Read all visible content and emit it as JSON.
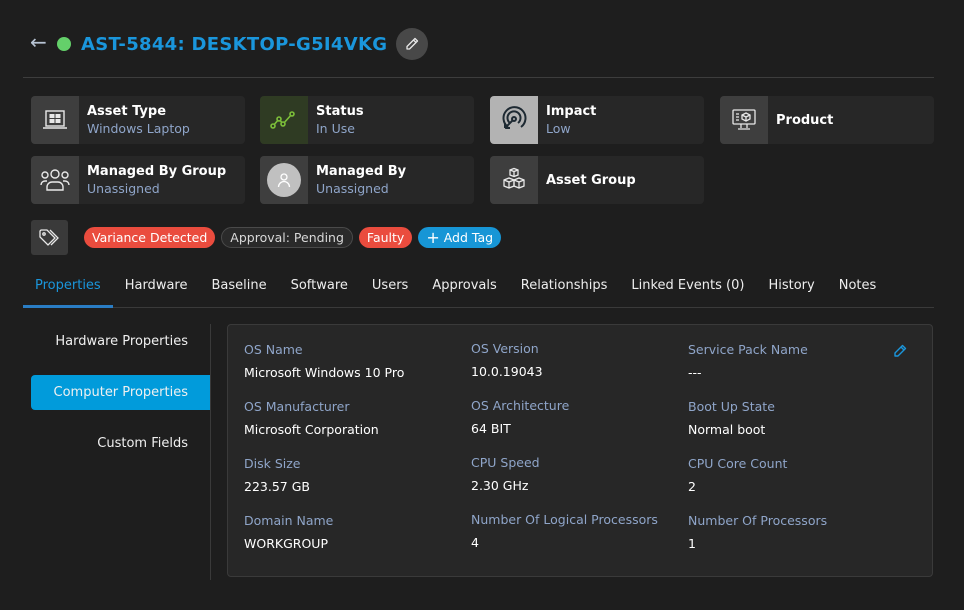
{
  "header": {
    "title": "AST-5844: DESKTOP-G5I4VKG",
    "back_icon": "arrow-left-icon",
    "status_color": "#64d06a",
    "edit_icon": "pencil-icon"
  },
  "cards": [
    {
      "label": "Asset Type",
      "value": "Windows Laptop",
      "icon": "windows-laptop-icon"
    },
    {
      "label": "Status",
      "value": "In Use",
      "icon": "status-line-icon"
    },
    {
      "label": "Impact",
      "value": "Low",
      "icon": "target-icon"
    },
    {
      "label": "Product",
      "value": "",
      "icon": "monitor-product-icon"
    },
    {
      "label": "Managed By Group",
      "value": "Unassigned",
      "icon": "users-group-icon"
    },
    {
      "label": "Managed By",
      "value": "Unassigned",
      "icon": "user-avatar-icon"
    },
    {
      "label": "Asset Group",
      "value": "",
      "icon": "boxes-icon"
    }
  ],
  "tags": {
    "icon": "tag-icon",
    "items": [
      {
        "label": "Variance Detected",
        "color": "#ea4c3e"
      },
      {
        "label": "Approval: Pending",
        "color": "#2a2a2a"
      },
      {
        "label": "Faulty",
        "color": "#ea4c3e"
      }
    ],
    "add_label": "Add Tag",
    "add_plus": "+"
  },
  "tabs": [
    {
      "label": "Properties",
      "active": true
    },
    {
      "label": "Hardware"
    },
    {
      "label": "Baseline"
    },
    {
      "label": "Software"
    },
    {
      "label": "Users"
    },
    {
      "label": "Approvals"
    },
    {
      "label": "Relationships"
    },
    {
      "label": "Linked Events (0)"
    },
    {
      "label": "History"
    },
    {
      "label": "Notes"
    }
  ],
  "subnav": [
    {
      "label": "Hardware Properties"
    },
    {
      "label": "Computer Properties",
      "active": true
    },
    {
      "label": "Custom Fields"
    }
  ],
  "properties": [
    {
      "label": "OS Name",
      "value": "Microsoft Windows 10 Pro"
    },
    {
      "label": "OS Version",
      "value": "10.0.19043"
    },
    {
      "label": "Service Pack Name",
      "value": "---"
    },
    {
      "label": "OS Manufacturer",
      "value": "Microsoft Corporation"
    },
    {
      "label": "OS Architecture",
      "value": "64 BIT"
    },
    {
      "label": "Boot Up State",
      "value": "Normal boot"
    },
    {
      "label": "Disk Size",
      "value": "223.57 GB"
    },
    {
      "label": "CPU Speed",
      "value": "2.30 GHz"
    },
    {
      "label": "CPU Core Count",
      "value": "2"
    },
    {
      "label": "Domain Name",
      "value": "WORKGROUP"
    },
    {
      "label": "Number Of Logical Processors",
      "value": "4"
    },
    {
      "label": "Number Of Processors",
      "value": "1"
    }
  ],
  "colors": {
    "accent": "#1a96dc",
    "active_subnav": "#019bdb",
    "tag_red": "#ea4c3e",
    "label": "#8fa5c9"
  }
}
